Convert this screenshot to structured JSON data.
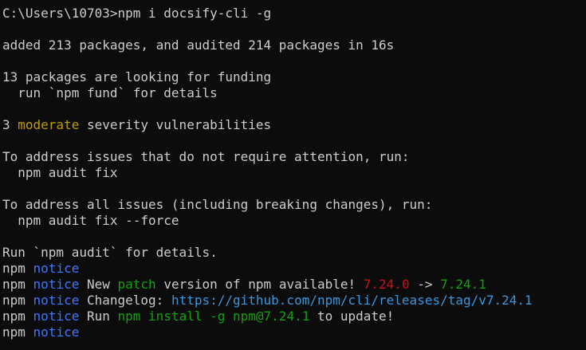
{
  "colors": {
    "background": "#0c0c0c",
    "text": "#cccccc",
    "moderate": "#c19c00",
    "notice": "#3b78ff",
    "green": "#13a10e",
    "red": "#c50f1f",
    "link": "#3a96dd"
  },
  "terminal": {
    "prompt": "C:\\Users\\10703>",
    "command": "npm i docsify-cli -g",
    "added": "added 213 packages, and audited 214 packages in 16s",
    "funding1": "13 packages are looking for funding",
    "funding2": "  run `npm fund` for details",
    "vuln_count": "3 ",
    "vuln_level": "moderate",
    "vuln_rest": " severity vulnerabilities",
    "address1": "To address issues that do not require attention, run:",
    "fix1": "  npm audit fix",
    "address2": "To address all issues (including breaking changes), run:",
    "fix2": "  npm audit fix --force",
    "run_audit": "Run `npm audit` for details.",
    "npm": "npm",
    "notice": "notice",
    "new_prefix": " New ",
    "patch": "patch",
    "new_mid": " version of npm available! ",
    "old_version": "7.24.0",
    "arrow": " -> ",
    "new_version": "7.24.1",
    "changelog_label": " Changelog: ",
    "changelog_url": "https://github.com/npm/cli/releases/tag/v7.24.1",
    "run_label": " Run ",
    "install_cmd": "npm install -g npm@7.24.1",
    "to_update": " to update!"
  }
}
